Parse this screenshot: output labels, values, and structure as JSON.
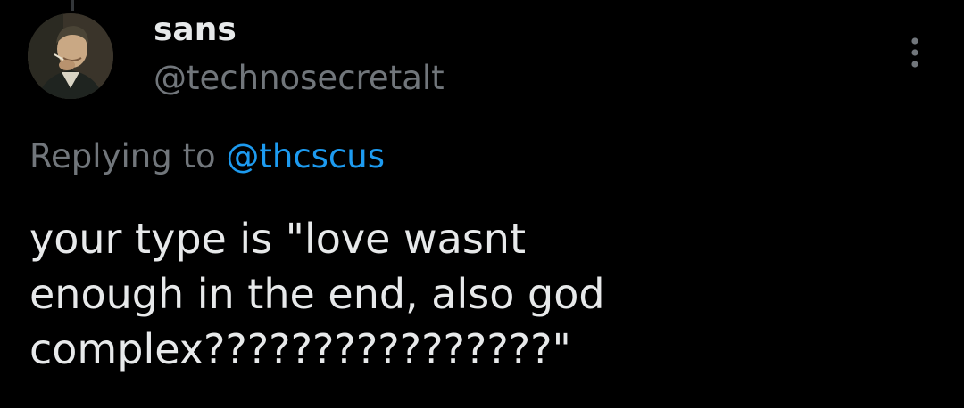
{
  "tweet": {
    "author": {
      "display_name": "sans",
      "handle": "@technosecretalt",
      "avatar_icon": "character-portrait-avatar"
    },
    "more_icon": "more-options-vertical-icon",
    "reply": {
      "prefix": "Replying to ",
      "mention": "@thcscus"
    },
    "text": "your type is \"love wasnt\nenough in the end, also god\ncomplex????????????????\""
  },
  "colors": {
    "background": "#000000",
    "primary_text": "#e7e9ea",
    "secondary_text": "#71767b",
    "link": "#1d9bf0"
  }
}
